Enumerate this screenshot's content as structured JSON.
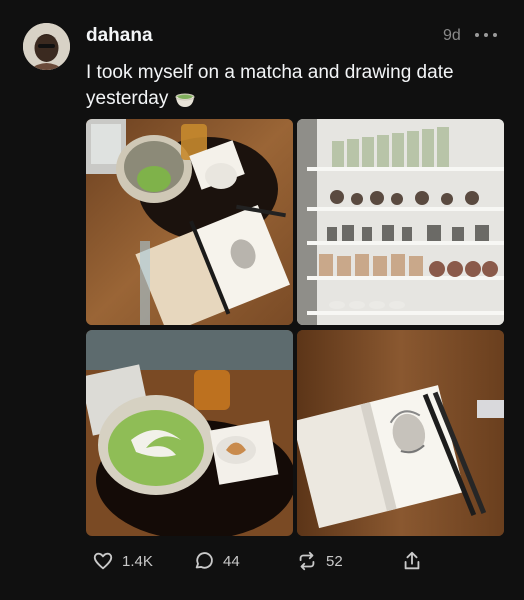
{
  "post": {
    "username": "dahana",
    "time": "9d",
    "text": "I took myself on a matcha and drawing date yesterday",
    "emoji_icon": "matcha-bowl-icon"
  },
  "photos": [
    {
      "name": "photo-matcha-sketchbook"
    },
    {
      "name": "photo-shop-shelves"
    },
    {
      "name": "photo-matcha-latte-art"
    },
    {
      "name": "photo-sketchbook-pencils"
    }
  ],
  "actions": {
    "likes": "1.4K",
    "replies": "44",
    "reposts": "52"
  },
  "colors": {
    "background": "#101010",
    "text": "#f3f5f7",
    "muted": "#8a8a8a"
  }
}
